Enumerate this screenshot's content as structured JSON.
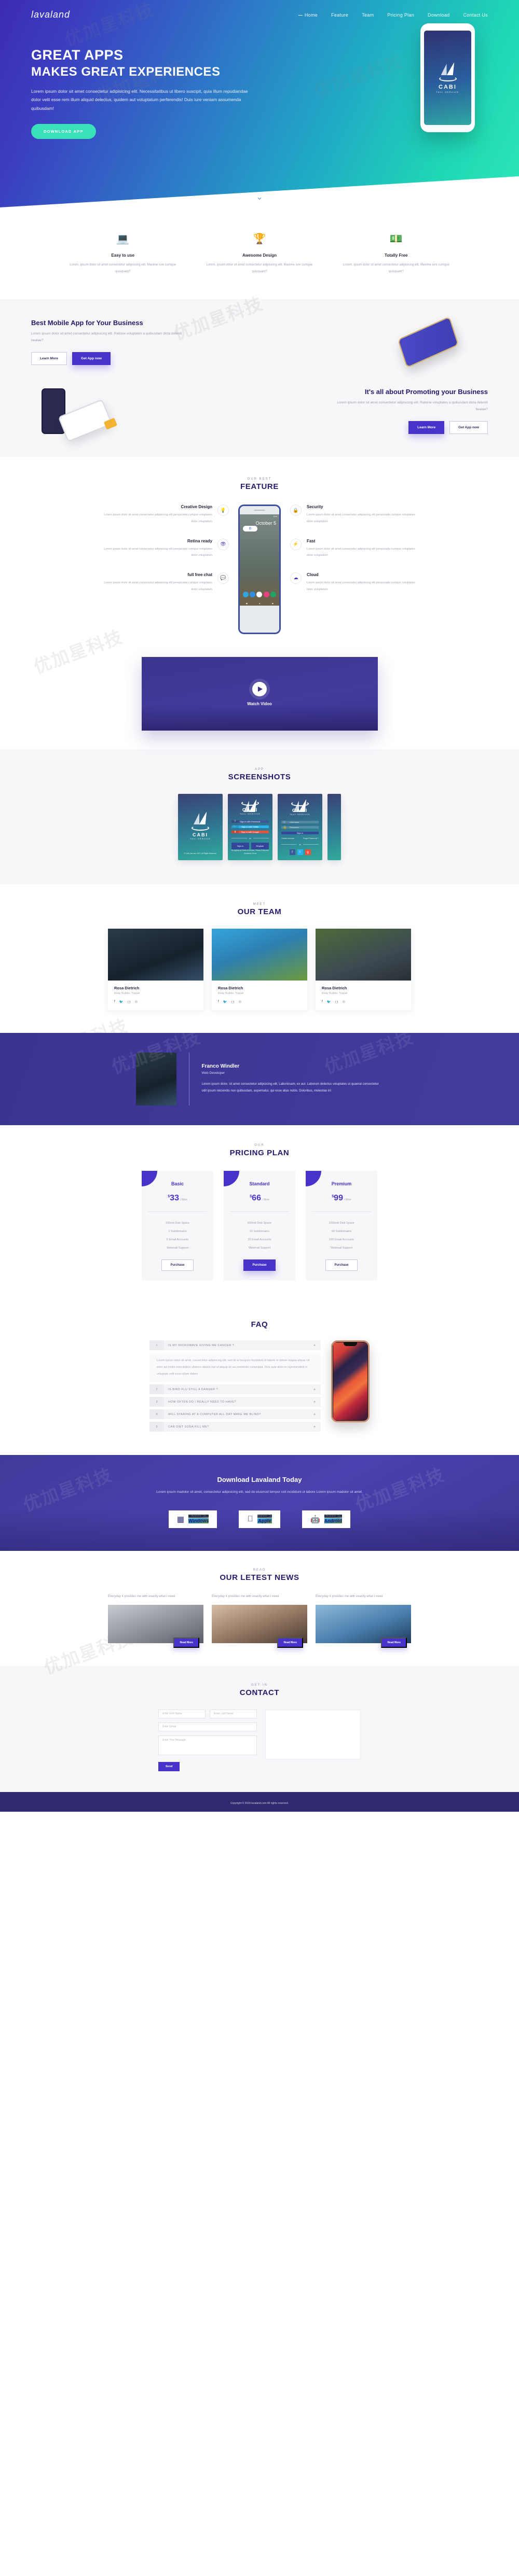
{
  "nav": {
    "logo": "lavaland",
    "links": [
      {
        "label": "Home",
        "active": true
      },
      {
        "label": "Feature",
        "active": false
      },
      {
        "label": "Team",
        "active": false
      },
      {
        "label": "Pricing Plan",
        "active": false
      },
      {
        "label": "Download",
        "active": false
      },
      {
        "label": "Contact Us",
        "active": false
      }
    ]
  },
  "hero": {
    "title_line1": "GREAT APPS",
    "title_line2": "MAKES GREAT  EXPERIENCES",
    "paragraph": "Lorem ipsum dolor sit amet consectetur adipisicing elit. Necessitatibus ut libero suscipit, quia illum repudiandae dolor velit esse rem illum aliquid delectus, quidem aut voluptatum perferendis! Duis iure veniam assumenda quibusdam!",
    "cta": "DOWNLOAD APP",
    "phone": {
      "brand": "CABI",
      "sub": "TAXI SERVICE"
    },
    "scroll_icon": "chevron-down-icon"
  },
  "features3": [
    {
      "icon": "laptop-icon",
      "title": "Easy to use",
      "text": "Lorem, ipsum dolor sit amet consectetur adipisicing elit. Maxime iure cumque quisquam?"
    },
    {
      "icon": "trophy-icon",
      "title": "Awesome Design",
      "text": "Lorem, ipsum dolor sit amet consectetur adipisicing elit. Maxime iure cumque quisquam?"
    },
    {
      "icon": "money-icon",
      "title": "Totally Free",
      "text": "Lorem, ipsum dolor sit amet consectetur adipisicing elit. Maxime iure cumque quisquam?"
    }
  ],
  "promo1": {
    "title": "Best Mobile App for Your Business",
    "text": "Lorem ipsum dolor sit amet consectetur adipisicing elit. Ratione voluptates a quibusdam dicta deleniti beatae?",
    "btn_outline": "Learn More",
    "btn_fill": "Get App now"
  },
  "promo2": {
    "title": "It's all about Promoting your Business",
    "text": "Lorem ipsum dolor sit amet consectetur adipisicing elit. Ratione voluptates a quibusdam dicta deleniti beatae?",
    "btn_fill": "Learn More",
    "btn_outline": "Get App now"
  },
  "feature": {
    "sub": "OUR BEST",
    "title": "FEATURE",
    "left": [
      {
        "icon": "lightbulb-icon",
        "title": "Creative Design",
        "text": "Lorem ipsum dolor sit amet consectetur adipisicing elit perspiciatis cumque voluptates dolor voluptatum"
      },
      {
        "icon": "eye-icon",
        "title": "Retina ready",
        "text": "Lorem ipsum dolor sit amet consectetur adipisicing elit perspiciatis cumque voluptates dolor voluptatum"
      },
      {
        "icon": "chat-icon",
        "title": "full free chat",
        "text": "Lorem ipsum dolor sit amet consectetur adipisicing elit perspiciatis cumque voluptates dolor voluptatum"
      }
    ],
    "right": [
      {
        "icon": "lock-icon",
        "title": "Security",
        "text": "Lorem ipsum dolor sit amet consectetur adipisicing elit perspiciatis cumque voluptates dolor voluptatum"
      },
      {
        "icon": "bolt-icon",
        "title": "Fast",
        "text": "Lorem ipsum dolor sit amet consectetur adipisicing elit perspiciatis cumque voluptates dolor voluptatum"
      },
      {
        "icon": "cloud-icon",
        "title": "Cloud",
        "text": "Lorem ipsum dolor sit amet consectetur adipisicing elit perspiciatis cumque voluptates dolor voluptatum"
      }
    ],
    "phone": {
      "date": "October 5",
      "status": "12:34",
      "search": "G"
    }
  },
  "video": {
    "label": "Watch Video",
    "play_icon": "play-icon"
  },
  "screenshots": {
    "sub": "APP",
    "title": "SCREENSHOTS",
    "slide1": {
      "brand": "CABI",
      "sub": "TAXI SERVICE",
      "footer": "© Cabi_taxi.com 2017 | All Rights Reserved."
    },
    "slide2": {
      "brand": "CABI",
      "sub": "TAXI SERVICE",
      "buttons": [
        {
          "label": "Sign in with Facebook",
          "icon": "facebook-icon",
          "color": "#3b5998"
        },
        {
          "label": "Sign in with Twitter",
          "icon": "twitter-icon",
          "color": "#2bb3ef"
        },
        {
          "label": "Sign in with Google",
          "icon": "google-plus-icon",
          "color": "#ec4f3a"
        }
      ],
      "or": "or",
      "signin": "Sign in",
      "register": "Register",
      "terms": "By signing up Terms of Service, Privacy Policy and Guarantee Terms"
    },
    "slide3": {
      "brand": "CABI",
      "sub": "TAXI SERVICE",
      "username_placeholder": "Username",
      "password_placeholder": "Password",
      "signin": "Sign in",
      "create_account": "Create Account",
      "forgot": "Forgot Password ?",
      "or": "or",
      "socials": [
        "facebook-icon",
        "twitter-icon",
        "google-plus-icon"
      ]
    }
  },
  "team": {
    "sub": "MEET",
    "title": "OUR TEAM",
    "members": [
      {
        "name": "Rosa Dietrich",
        "role": "Body Builder Trainer",
        "socials": [
          "facebook-icon",
          "twitter-icon",
          "instagram-icon",
          "dribbble-icon"
        ]
      },
      {
        "name": "Rosa Dietrich",
        "role": "Body Builder Trainer",
        "socials": [
          "facebook-icon",
          "twitter-icon",
          "instagram-icon",
          "dribbble-icon"
        ]
      },
      {
        "name": "Rosa Dietrich",
        "role": "Body Builder Trainer",
        "socials": [
          "facebook-icon",
          "twitter-icon",
          "instagram-icon",
          "dribbble-icon"
        ]
      }
    ]
  },
  "testimonial": {
    "name": "Franco Windler",
    "role": "Web Developer",
    "text": "Lorem ipsum dolor, sit amet consectetur adipisicing elit. Laboriosam, ex aut. Laborum delectus voluptates ut quaerat consectetur odit ipsum reiciendis non quibusdam, aspernatur, qui esse alias nobis. Doloribus, molestias in!"
  },
  "pricing": {
    "sub": "OUR",
    "title": "PRICING PLAN",
    "plans": [
      {
        "name": "Basic",
        "currency": "$",
        "price": "33",
        "period": "/ Mon",
        "featured": false,
        "features": [
          "100mb Disk Space",
          "2 Subdomains",
          "5 Email Accounts",
          "Webmail Support"
        ],
        "cta": "Purchase"
      },
      {
        "name": "Standard",
        "currency": "$",
        "price": "66",
        "period": "/ Mon",
        "featured": true,
        "features": [
          "500mb Disk Space",
          "10 Subdomains",
          "20 Email Accounts",
          "Webmail Support"
        ],
        "cta": "Purchase"
      },
      {
        "name": "Premium",
        "currency": "$",
        "price": "99",
        "period": "/ Mon",
        "featured": false,
        "features": [
          "1000mb Disk Space",
          "50 Subdomains",
          "100 Email Accounts",
          "Webmail Support"
        ],
        "cta": "Purchase"
      }
    ]
  },
  "faq": {
    "title": "FAQ",
    "items": [
      {
        "num": "1",
        "q": "IS MY MICROWAVE GIVING ME CANCER ?",
        "open": true,
        "a": "Lorem ipsum dolor sit amet, consectetur adipisicing elit, sed do ei temporo incididunt ut labore et dolore magna aliqua. Ut enim ad minim exercitation ullamco laboris nisi ut aliquip ex ea commodo consequat. Duis aute dolor in reprehenderit in voluptate velit esse cillum dolore"
      },
      {
        "num": "2",
        "q": "IS BIRD FLU STILL A DANGER ?",
        "open": false,
        "a": ""
      },
      {
        "num": "3",
        "q": "HOW OFTEN DO I REALLY NEED TO HAVE?",
        "open": false,
        "a": ""
      },
      {
        "num": "4",
        "q": "WILL STARING AT A COMPUTER ALL DAY MAKE ME BLIND?",
        "open": false,
        "a": ""
      },
      {
        "num": "5",
        "q": "CAN DIET SODA KILL ME?",
        "open": false,
        "a": ""
      }
    ]
  },
  "download": {
    "title": "Download Lavaland Today",
    "text": "Lorem ipsum madolor sit amet, consectetur adipisicing elit, sed do eiusmod tempor coli incididunt ut labore Lorem ipsum madolor sit amet.",
    "buttons": [
      {
        "icon": "windows-icon",
        "small": "Available On",
        "big": "Windows"
      },
      {
        "icon": "apple-icon",
        "small": "Available On",
        "big": "Apple"
      },
      {
        "icon": "android-icon",
        "small": "Available On",
        "big": "Android"
      }
    ]
  },
  "news": {
    "sub": "READ",
    "title": "OUR LETEST NEWS",
    "cards": [
      {
        "excerpt": "Everyday it provides me with exactly what I need",
        "cta": "Read More"
      },
      {
        "excerpt": "Everyday it provides me with exactly what I need",
        "cta": "Read More"
      },
      {
        "excerpt": "Everyday it provides me with exactly what I need",
        "cta": "Read More"
      }
    ]
  },
  "contact": {
    "sub": "GET IN",
    "title": "CONTACT",
    "first_name_placeholder": "Enter First Name",
    "last_name_placeholder": "Enter Last Name",
    "email_placeholder": "Enter Email",
    "message_placeholder": "Enter Your Message",
    "send": "Send"
  },
  "footer": {
    "copyright": "Copyright © 2018 lavaland.com All rights reserved."
  },
  "watermarks": [
    "优加星科技"
  ]
}
